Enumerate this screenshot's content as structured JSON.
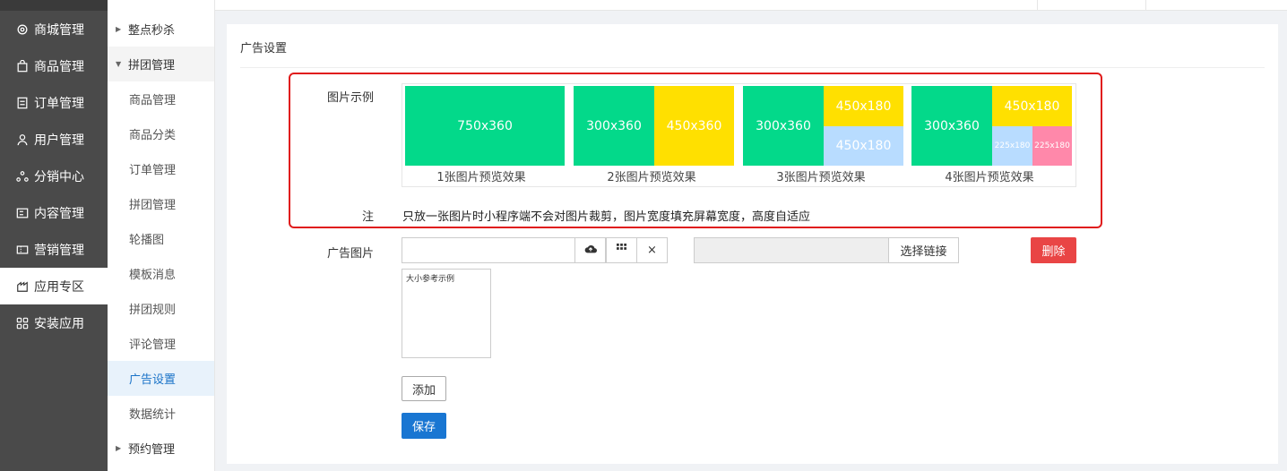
{
  "nav1": {
    "items": [
      {
        "label": "商城管理",
        "icon": "gear-icon"
      },
      {
        "label": "商品管理",
        "icon": "bag-icon"
      },
      {
        "label": "订单管理",
        "icon": "order-icon"
      },
      {
        "label": "用户管理",
        "icon": "user-icon"
      },
      {
        "label": "分销中心",
        "icon": "distribution-icon"
      },
      {
        "label": "内容管理",
        "icon": "content-icon"
      },
      {
        "label": "营销管理",
        "icon": "ticket-icon"
      },
      {
        "label": "应用专区",
        "icon": "app-icon"
      },
      {
        "label": "安装应用",
        "icon": "grid-icon"
      }
    ],
    "active": "应用专区"
  },
  "nav2": {
    "groups": [
      {
        "label": "整点秒杀"
      },
      {
        "label": "拼团管理"
      },
      {
        "label": "预约管理"
      }
    ],
    "items": [
      "商品管理",
      "商品分类",
      "订单管理",
      "拼团管理",
      "轮播图",
      "模板消息",
      "拼团规则",
      "评论管理",
      "广告设置",
      "数据统计"
    ],
    "active": "广告设置"
  },
  "card": {
    "title": "广告设置",
    "examples_label": "图片示例",
    "examples": [
      {
        "caption": "1张图片预览效果",
        "blocks": [
          "750x360"
        ]
      },
      {
        "caption": "2张图片预览效果",
        "blocks": [
          "300x360",
          "450x360"
        ]
      },
      {
        "caption": "3张图片预览效果",
        "blocks": [
          "300x360",
          "450x180",
          "450x180"
        ]
      },
      {
        "caption": "4张图片预览效果",
        "blocks": [
          "300x360",
          "450x180",
          "225x180",
          "225x180"
        ]
      }
    ],
    "note_label": "注",
    "note_text": "只放一张图片时小程序端不会对图片裁剪，图片宽度填充屏幕宽度，高度自适应",
    "ad_image_label": "广告图片",
    "upload_close": "×",
    "choose_link": "选择链接",
    "delete": "删除",
    "preview_text": "大小参考示例",
    "add": "添加",
    "save": "保存"
  },
  "colors": {
    "green": "#03d98a",
    "yellow": "#ffe000",
    "blue": "#b8dcff",
    "pink": "#ff88aa",
    "danger": "#e94545",
    "primary": "#1976d2",
    "highlight": "#e01b1b"
  }
}
